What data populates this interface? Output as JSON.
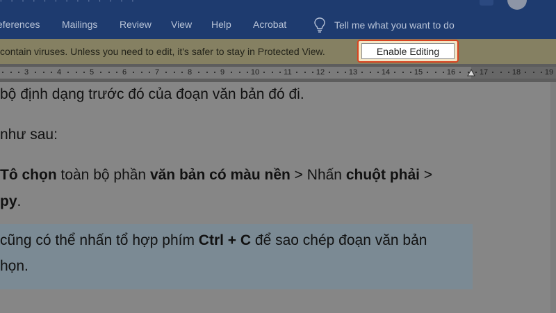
{
  "ribbon": {
    "tabs": [
      "eferences",
      "Mailings",
      "Review",
      "View",
      "Help",
      "Acrobat"
    ],
    "tell_me": "Tell me what you want to do"
  },
  "message_bar": {
    "text": "contain viruses. Unless you need to edit, it's safer to stay in Protected View.",
    "button": "Enable Editing"
  },
  "ruler": {
    "numbers": [
      "3",
      "4",
      "5",
      "6",
      "7",
      "8",
      "9",
      "10",
      "11",
      "12",
      "13",
      "14",
      "15",
      "16",
      "17",
      "18",
      "19"
    ]
  },
  "document": {
    "line1": "bộ định dạng trước đó của đoạn văn bản đó đi.",
    "line2": "như sau:",
    "line3": {
      "b1": "Tô chọn",
      "t1": " toàn bộ phần ",
      "b2": "văn bản có màu nền",
      "t2": " > Nhấn ",
      "b3": "chuột phải",
      "t3": " >"
    },
    "line4": {
      "b1": "py",
      "t1": "."
    },
    "line5": {
      "t1": "cũng có thể nhấn tổ hợp phím ",
      "b1": "Ctrl + C",
      "t2": " để sao chép đoạn văn bản"
    },
    "line6": "họn."
  },
  "colors": {
    "ribbon": "#1e3b6f",
    "message_bar": "#858062",
    "highlight_border": "#d8431f",
    "page": "#868686",
    "selection_highlight": "#7b8a94"
  }
}
